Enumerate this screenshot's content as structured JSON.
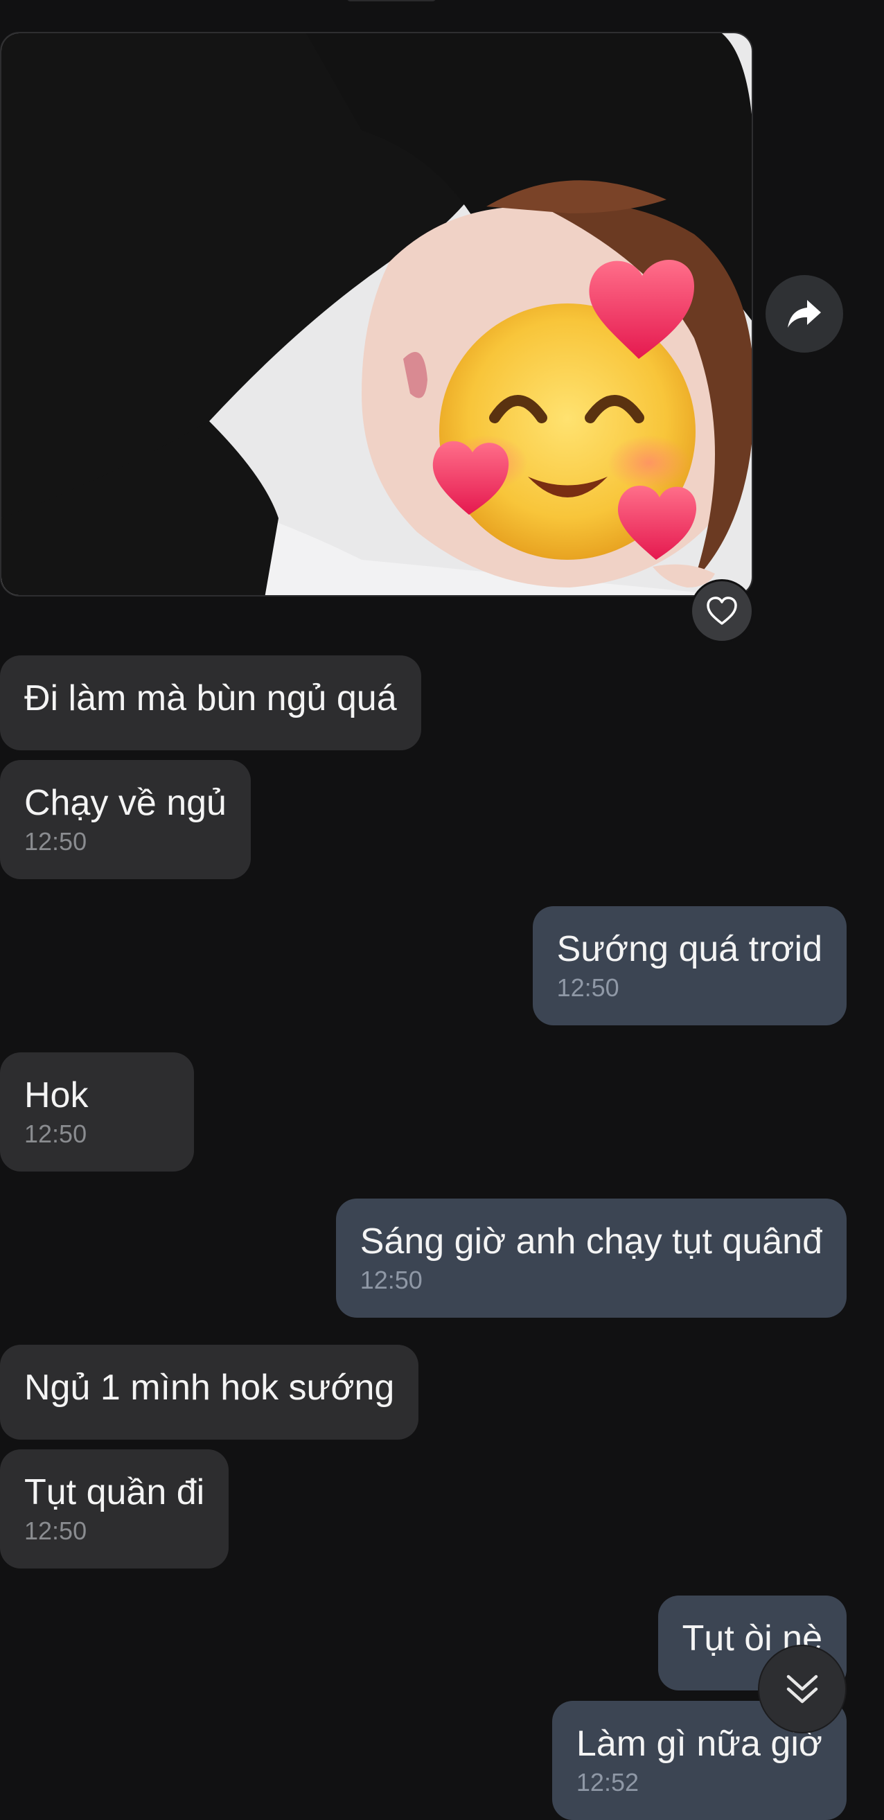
{
  "messages": [
    {
      "text": "Đi làm mà bùn ngủ quá"
    },
    {
      "text": "Chạy về ngủ",
      "time": "12:50"
    },
    {
      "text": "Sướng quá trơid",
      "time": "12:50"
    },
    {
      "text": "Hok",
      "time": "12:50"
    },
    {
      "text": "Sáng giờ anh chạy tụt quânđ",
      "time": "12:50"
    },
    {
      "text": "Ngủ 1 mình hok sướng"
    },
    {
      "text": "Tụt quần đi",
      "time": "12:50"
    },
    {
      "text": "Tụt òi nè"
    },
    {
      "text": "Làm gì nữa giờ",
      "time": "12:52"
    }
  ],
  "icons": {
    "share": "share-forward-icon",
    "like": "heart-outline-icon",
    "scroll": "double-chevron-down-icon",
    "sticker": "smiling-face-with-hearts-emoji"
  },
  "colors": {
    "background": "#111112",
    "incoming_bubble": "#2d2d2f",
    "outgoing_bubble": "#3c4553",
    "timestamp": "#8a8c90"
  }
}
